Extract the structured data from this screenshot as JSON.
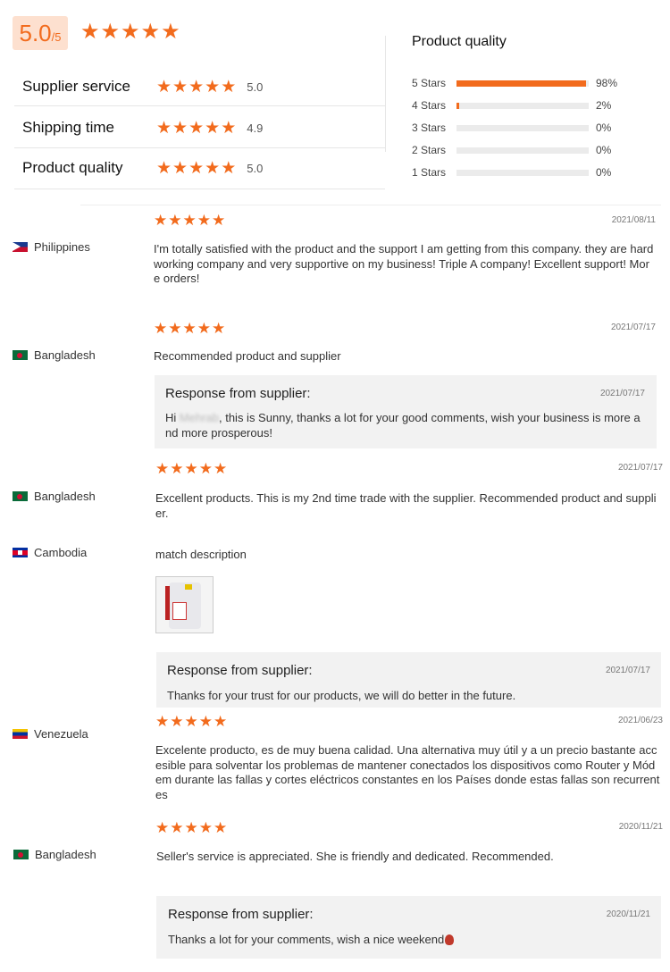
{
  "summary": {
    "score": "5.0",
    "score_suffix": "/5",
    "rows": [
      {
        "label": "Supplier service",
        "value": "5.0"
      },
      {
        "label": "Shipping time",
        "value": "4.9"
      },
      {
        "label": "Product quality",
        "value": "5.0"
      }
    ]
  },
  "breakdown": {
    "title": "Product quality",
    "bars": [
      {
        "label": "5 Stars",
        "percent": "98%",
        "fraction": 0.98
      },
      {
        "label": "4 Stars",
        "percent": "2%",
        "fraction": 0.02
      },
      {
        "label": "3 Stars",
        "percent": "0%",
        "fraction": 0
      },
      {
        "label": "2 Stars",
        "percent": "0%",
        "fraction": 0
      },
      {
        "label": "1 Stars",
        "percent": "0%",
        "fraction": 0
      }
    ]
  },
  "reviews": [
    {
      "country": "Philippines",
      "date": "2021/08/11",
      "rating": 5,
      "text": "I'm totally satisfied with the product and the support I am getting from this company. they are hardworking company and very supportive on my business! Triple A company! Excellent support! More orders!"
    },
    {
      "country": "Bangladesh",
      "date": "2021/07/17",
      "rating": 5,
      "text": "Recommended product and supplier",
      "response": {
        "title": "Response from supplier:",
        "date": "2021/07/17",
        "greeting": "Hi",
        "name": "Mehrab",
        "text": ", this is Sunny, thanks a lot for your good comments, wish your business is more and more prosperous!"
      }
    },
    {
      "country": "Bangladesh",
      "date": "2021/07/17",
      "rating": 5,
      "text": "Excellent products. This is my 2nd time trade with the supplier. Recommended product and supplier."
    },
    {
      "country": "Cambodia",
      "text": "match description",
      "response": {
        "title": "Response from supplier:",
        "date": "2021/07/17",
        "text": "Thanks for your trust for our products, we will do better in the future."
      }
    },
    {
      "country": "Venezuela",
      "date": "2021/06/23",
      "rating": 5,
      "text": "Excelente producto, es de muy buena calidad. Una alternativa muy útil y a un precio bastante accesible para solventar los problemas de mantener conectados los dispositivos como Router y Módem durante las fallas y cortes eléctricos constantes en los Países donde estas fallas son recurrentes"
    },
    {
      "country": "Bangladesh",
      "date": "2020/11/21",
      "rating": 5,
      "text": "Seller's service is appreciated. She is friendly and dedicated. Recommended.",
      "response": {
        "title": "Response from supplier:",
        "date": "2020/11/21",
        "text": "Thanks a lot for your comments, wish a nice weekend"
      }
    }
  ],
  "colors": {
    "accent": "#f26b1d",
    "badge_bg": "#fde0cf",
    "response_bg": "#f2f2f2"
  },
  "icons": {
    "star": "star-icon",
    "flag": "flag-icon"
  }
}
